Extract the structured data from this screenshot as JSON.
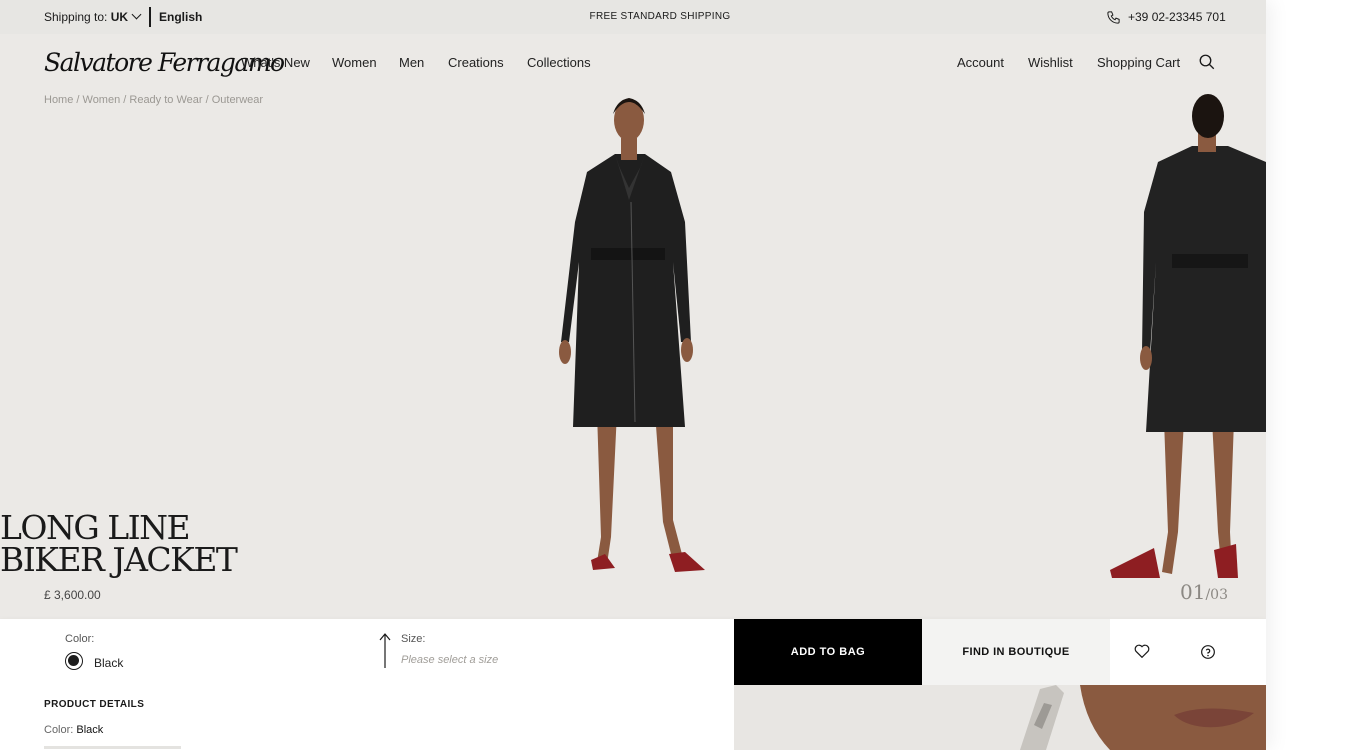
{
  "topbar": {
    "shipping_label": "Shipping to:",
    "shipping_country": "UK",
    "language": "English",
    "promo": "FREE STANDARD SHIPPING",
    "phone": "+39 02-23345 701"
  },
  "brand": {
    "logo_text": "Salvatore Ferragamo"
  },
  "nav": {
    "items": [
      "What's New",
      "Women",
      "Men",
      "Creations",
      "Collections"
    ],
    "utility": [
      "Account",
      "Wishlist",
      "Shopping Cart"
    ]
  },
  "breadcrumb": "Home / Women / Ready to Wear / Outerwear",
  "product": {
    "title_line1": "LONG LINE",
    "title_line2": "BIKER JACKET",
    "price": "£ 3,600.00",
    "image_current": "01",
    "image_total": "/03"
  },
  "buybar": {
    "color_label": "Color:",
    "color_value": "Black",
    "size_label": "Size:",
    "size_placeholder": "Please select a size",
    "add_to_bag": "ADD TO BAG",
    "find_in_boutique": "FIND IN BOUTIQUE"
  },
  "details": {
    "heading": "PRODUCT DETAILS",
    "color_label": "Color:",
    "color_value": "Black"
  },
  "colors": {
    "background": "#ebe9e6",
    "primary_button": "#000000",
    "secondary_button": "#f3f3f2"
  },
  "icons": [
    "chevron-down-icon",
    "phone-icon",
    "search-icon",
    "size-arrow-icon",
    "heart-icon",
    "help-icon"
  ]
}
